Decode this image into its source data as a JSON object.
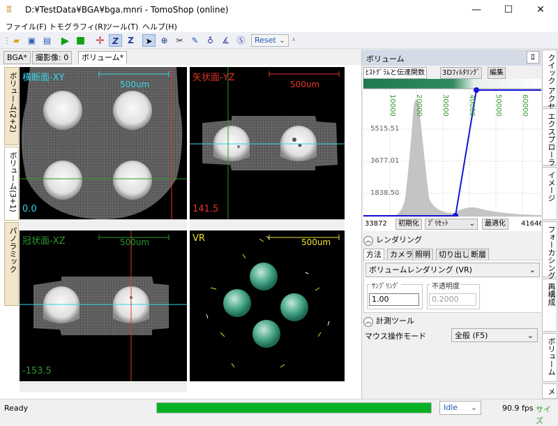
{
  "window": {
    "title": "D:¥TestData¥BGA¥bga.mnri - TomoShop (online)",
    "minimize": "—",
    "maximize": "☐",
    "close": "✕"
  },
  "menu": [
    "ファイル(F)",
    "トモグラフィ(R)",
    "ツール(T)",
    "ヘルプ(H)"
  ],
  "toolbar": {
    "icons": [
      "open-folder-icon",
      "save-icon",
      "save-all-icon",
      "play-icon",
      "stop-icon",
      "crosshair-icon",
      "z-axis-icon",
      "z-search-icon",
      "pointer-icon",
      "zoom-icon",
      "scissors-icon",
      "pen-icon",
      "measure-icon",
      "angle-icon",
      "s-circle-icon"
    ],
    "reset_label": "Reset"
  },
  "doc_tabs": [
    "BGA*",
    "撮影像: 0",
    "ボリューム*"
  ],
  "left_tabs": [
    "ボリューム(2+2)",
    "ボリューム(3+1)",
    "パノラミック"
  ],
  "viewports": {
    "axial": {
      "label": "横断面-XY",
      "scale": "500um",
      "value": "0.0"
    },
    "sagittal": {
      "label": "矢状面-YZ",
      "scale": "500um",
      "value": "141.5"
    },
    "coronal": {
      "label": "冠状面-XZ",
      "scale": "500um",
      "value": "-153.5"
    },
    "vr": {
      "label": "VR",
      "scale": "500um"
    }
  },
  "right_panel": {
    "title": "ボリューム",
    "pin": "ﾛ",
    "subtabs": [
      "ﾋｽﾄｸﾞﾗﾑと伝達関数",
      "3Dﾌｨﾙﾀﾘﾝｸﾞ",
      "編集"
    ],
    "histogram": {
      "x_ticks": [
        "10000",
        "20000",
        "30000",
        "40000",
        "50000",
        "60000"
      ],
      "y_ticks": [
        "5515.51",
        "3677.01",
        "1838.50"
      ],
      "min": "33872",
      "max": "41646",
      "init_label": "初期化",
      "preset_label": "ﾌﾟﾘｾｯﾄ",
      "optimize_label": "最適化"
    },
    "rendering": {
      "header": "レンダリング",
      "tabs": [
        "方法",
        "カメラ",
        "照明",
        "切り出し",
        "断層"
      ],
      "method": "ボリュームレンダリング (VR)",
      "sampling_label": "ｻﾝﾌﾟﾘﾝｸﾞ",
      "sampling_value": "1.00",
      "opacity_label": "不透明度",
      "opacity_value": "0.2000"
    },
    "measure": {
      "header": "計測ツール",
      "mode_label": "マウス操作モード",
      "mode_value": "全般 (F5)"
    }
  },
  "side_tabs": [
    "クイック アクセス",
    "エクスプローラ",
    "イメージ",
    "フォーカシング",
    "再構成",
    "ボリューム",
    "メ"
  ],
  "status": {
    "text": "Ready",
    "progress": 1.0,
    "state": "Idle",
    "fps": "90.9 fps",
    "size": "サイズ"
  },
  "colors": {
    "axial": "#35d5e8",
    "sagittal": "#e8322a",
    "coronal": "#2a9a2a",
    "vr": "#f0e030",
    "progress": "#06b025"
  }
}
